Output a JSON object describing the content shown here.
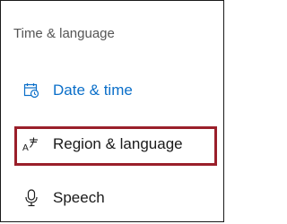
{
  "section": {
    "title": "Time & language"
  },
  "nav": {
    "items": [
      {
        "label": "Date & time",
        "icon": "calendar-clock-icon",
        "active": true
      },
      {
        "label": "Region & language",
        "icon": "region-language-icon",
        "active": false
      },
      {
        "label": "Speech",
        "icon": "microphone-icon",
        "active": false
      }
    ]
  },
  "colors": {
    "accent": "#0b6fc9",
    "highlight_border": "#9a1f2a",
    "text": "#1a1a1a",
    "muted_text": "#555555"
  }
}
